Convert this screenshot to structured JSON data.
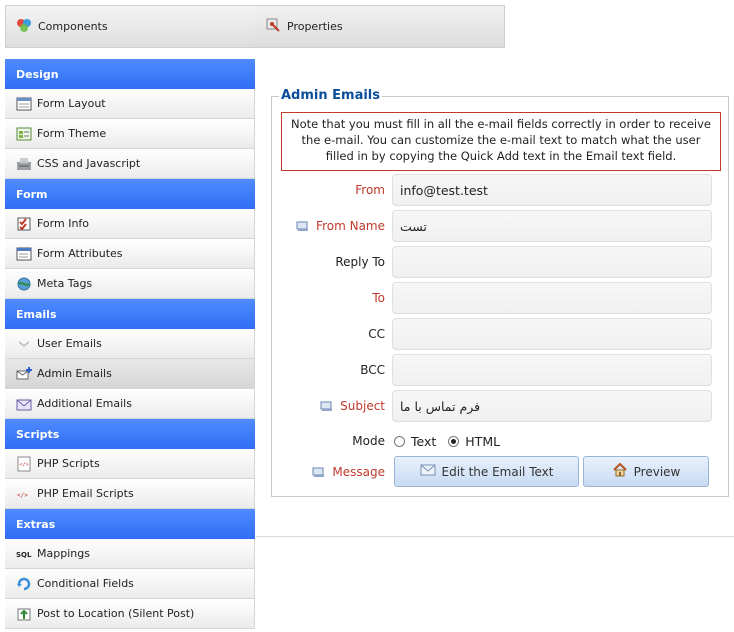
{
  "tabs": [
    {
      "label": "Components",
      "icon": "components-icon"
    },
    {
      "label": "Properties",
      "icon": "properties-icon"
    }
  ],
  "sidebar": {
    "sections": [
      {
        "title": "Design",
        "items": [
          {
            "label": "Form Layout",
            "icon": "form-layout-icon"
          },
          {
            "label": "Form Theme",
            "icon": "form-theme-icon"
          },
          {
            "label": "CSS and Javascript",
            "icon": "css-javascript-icon"
          }
        ]
      },
      {
        "title": "Form",
        "items": [
          {
            "label": "Form Info",
            "icon": "form-info-icon"
          },
          {
            "label": "Form Attributes",
            "icon": "form-attributes-icon"
          },
          {
            "label": "Meta Tags",
            "icon": "meta-tags-icon"
          }
        ]
      },
      {
        "title": "Emails",
        "items": [
          {
            "label": "User Emails",
            "icon": "user-emails-icon"
          },
          {
            "label": "Admin Emails",
            "icon": "admin-emails-icon",
            "selected": true
          },
          {
            "label": "Additional Emails",
            "icon": "additional-emails-icon"
          }
        ]
      },
      {
        "title": "Scripts",
        "items": [
          {
            "label": "PHP Scripts",
            "icon": "php-scripts-icon"
          },
          {
            "label": "PHP Email Scripts",
            "icon": "php-email-scripts-icon"
          }
        ]
      },
      {
        "title": "Extras",
        "items": [
          {
            "label": "Mappings",
            "icon": "sql-mappings-icon"
          },
          {
            "label": "Conditional Fields",
            "icon": "conditional-fields-icon"
          },
          {
            "label": "Post to Location (Silent Post)",
            "icon": "post-location-icon"
          }
        ]
      }
    ]
  },
  "admin_emails": {
    "legend": "Admin Emails",
    "note": "Note that you must fill in all the e-mail fields correctly in order to receive the e-mail. You can customize the e-mail text to match what the user filled in by copying the Quick Add text in the Email text field.",
    "fields": {
      "from": {
        "label": "From",
        "value": "info@test.test"
      },
      "from_name": {
        "label": "From Name",
        "value": "تست"
      },
      "reply_to": {
        "label": "Reply To",
        "value": ""
      },
      "to": {
        "label": "To",
        "value": ""
      },
      "cc": {
        "label": "CC",
        "value": ""
      },
      "bcc": {
        "label": "BCC",
        "value": ""
      },
      "subject": {
        "label": "Subject",
        "value": "فرم تماس با ما"
      }
    },
    "mode": {
      "label": "Mode",
      "options": [
        "Text",
        "HTML"
      ],
      "selected": "HTML"
    },
    "message": {
      "label": "Message",
      "edit_button": "Edit the Email Text",
      "preview_button": "Preview"
    }
  },
  "colors": {
    "section_header": "#3a7bff",
    "required_label": "#c0392b",
    "legend": "#0b4f9a"
  }
}
